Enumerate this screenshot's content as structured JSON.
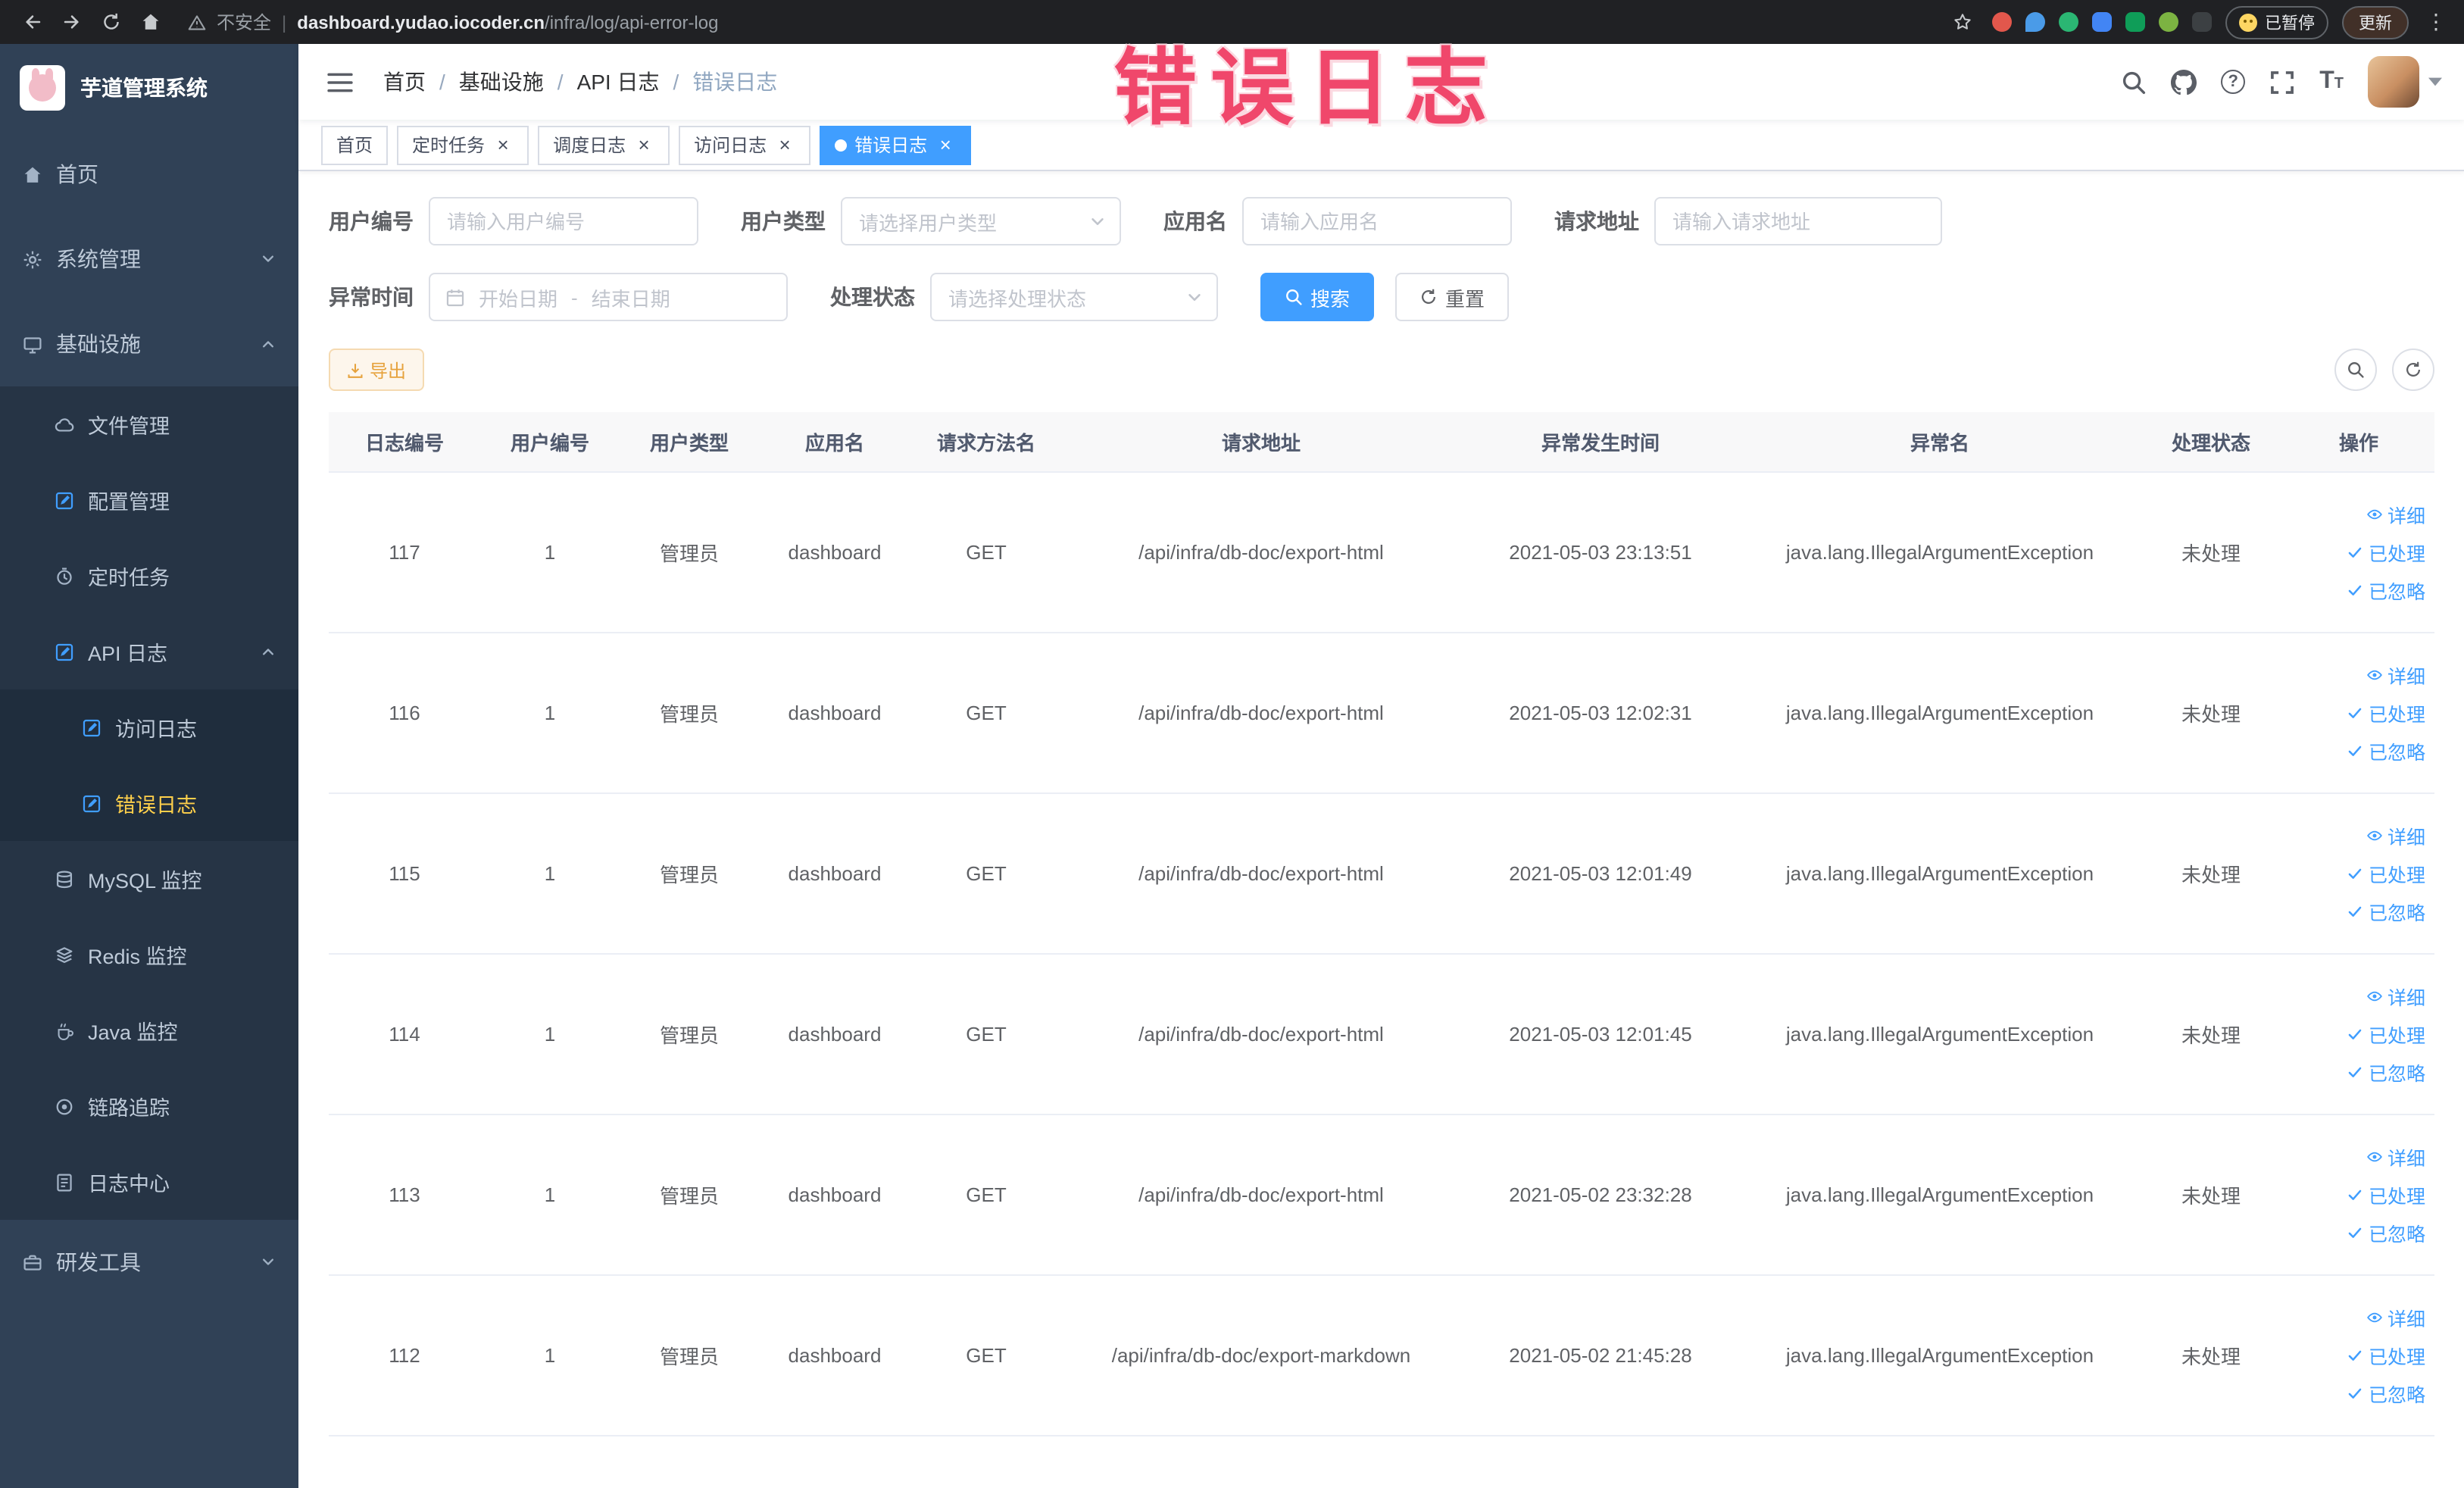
{
  "browser": {
    "security_label": "不安全",
    "url_separator": "|",
    "url_domain": "dashboard.yudao.iocoder.cn",
    "url_path": "/infra/log/api-error-log",
    "paused_chip": "已暂停",
    "update_chip": "更新"
  },
  "annotation": {
    "text": "错误日志"
  },
  "sidebar": {
    "logo_title": "芋道管理系统",
    "menu": [
      {
        "label": "首页",
        "icon": "home-icon",
        "level": 0
      },
      {
        "label": "系统管理",
        "icon": "gear-icon",
        "level": 0,
        "chevron": "down"
      },
      {
        "label": "基础设施",
        "icon": "monitor-icon",
        "level": 0,
        "chevron": "up"
      },
      {
        "label": "文件管理",
        "icon": "cloud-icon",
        "level": 1
      },
      {
        "label": "配置管理",
        "icon": "edit-square-icon",
        "level": 1
      },
      {
        "label": "定时任务",
        "icon": "timer-icon",
        "level": 1
      },
      {
        "label": "API 日志",
        "icon": "api-log-icon",
        "level": 1,
        "chevron": "up"
      },
      {
        "label": "访问日志",
        "icon": "access-log-icon",
        "level": 2
      },
      {
        "label": "错误日志",
        "icon": "error-log-icon",
        "level": 2,
        "active": true
      },
      {
        "label": "MySQL 监控",
        "icon": "database-icon",
        "level": 1
      },
      {
        "label": "Redis 监控",
        "icon": "redis-icon",
        "level": 1
      },
      {
        "label": "Java 监控",
        "icon": "java-icon",
        "level": 1
      },
      {
        "label": "链路追踪",
        "icon": "trace-icon",
        "level": 1
      },
      {
        "label": "日志中心",
        "icon": "log-center-icon",
        "level": 1
      },
      {
        "label": "研发工具",
        "icon": "tools-icon",
        "level": 0,
        "chevron": "down"
      }
    ]
  },
  "header": {
    "breadcrumb": [
      "首页",
      "基础设施",
      "API 日志",
      "错误日志"
    ],
    "breadcrumb_separator": "/"
  },
  "tabs": [
    {
      "label": "首页",
      "closable": false,
      "active": false
    },
    {
      "label": "定时任务",
      "closable": true,
      "active": false
    },
    {
      "label": "调度日志",
      "closable": true,
      "active": false
    },
    {
      "label": "访问日志",
      "closable": true,
      "active": false
    },
    {
      "label": "错误日志",
      "closable": true,
      "active": true
    }
  ],
  "filters": {
    "user_id": {
      "label": "用户编号",
      "placeholder": "请输入用户编号"
    },
    "user_type": {
      "label": "用户类型",
      "placeholder": "请选择用户类型"
    },
    "app_name": {
      "label": "应用名",
      "placeholder": "请输入应用名"
    },
    "request_url": {
      "label": "请求地址",
      "placeholder": "请输入请求地址"
    },
    "exception_time": {
      "label": "异常时间",
      "start_placeholder": "开始日期",
      "separator": "-",
      "end_placeholder": "结束日期"
    },
    "process_status": {
      "label": "处理状态",
      "placeholder": "请选择处理状态"
    },
    "search_label": "搜索",
    "reset_label": "重置"
  },
  "toolbar": {
    "export_label": "导出"
  },
  "table": {
    "columns": [
      "日志编号",
      "用户编号",
      "用户类型",
      "应用名",
      "请求方法名",
      "请求地址",
      "异常发生时间",
      "异常名",
      "处理状态",
      "操作"
    ],
    "rows": [
      {
        "log_id": "117",
        "user_id": "1",
        "user_type": "管理员",
        "app_name": "dashboard",
        "method": "GET",
        "request_url": "/api/infra/db-doc/export-html",
        "time": "2021-05-03 23:13:51",
        "exception": "java.lang.IllegalArgumentException",
        "status": "未处理"
      },
      {
        "log_id": "116",
        "user_id": "1",
        "user_type": "管理员",
        "app_name": "dashboard",
        "method": "GET",
        "request_url": "/api/infra/db-doc/export-html",
        "time": "2021-05-03 12:02:31",
        "exception": "java.lang.IllegalArgumentException",
        "status": "未处理"
      },
      {
        "log_id": "115",
        "user_id": "1",
        "user_type": "管理员",
        "app_name": "dashboard",
        "method": "GET",
        "request_url": "/api/infra/db-doc/export-html",
        "time": "2021-05-03 12:01:49",
        "exception": "java.lang.IllegalArgumentException",
        "status": "未处理"
      },
      {
        "log_id": "114",
        "user_id": "1",
        "user_type": "管理员",
        "app_name": "dashboard",
        "method": "GET",
        "request_url": "/api/infra/db-doc/export-html",
        "time": "2021-05-03 12:01:45",
        "exception": "java.lang.IllegalArgumentException",
        "status": "未处理"
      },
      {
        "log_id": "113",
        "user_id": "1",
        "user_type": "管理员",
        "app_name": "dashboard",
        "method": "GET",
        "request_url": "/api/infra/db-doc/export-html",
        "time": "2021-05-02 23:32:28",
        "exception": "java.lang.IllegalArgumentException",
        "status": "未处理"
      },
      {
        "log_id": "112",
        "user_id": "1",
        "user_type": "管理员",
        "app_name": "dashboard",
        "method": "GET",
        "request_url": "/api/infra/db-doc/export-markdown",
        "time": "2021-05-02 21:45:28",
        "exception": "java.lang.IllegalArgumentException",
        "status": "未处理"
      }
    ],
    "row_actions": [
      {
        "label": "详细",
        "icon": "eye-icon",
        "name": "detail-link"
      },
      {
        "label": "已处理",
        "icon": "check-icon",
        "name": "processed-link"
      },
      {
        "label": "已忽略",
        "icon": "check-icon",
        "name": "ignored-link"
      }
    ]
  }
}
